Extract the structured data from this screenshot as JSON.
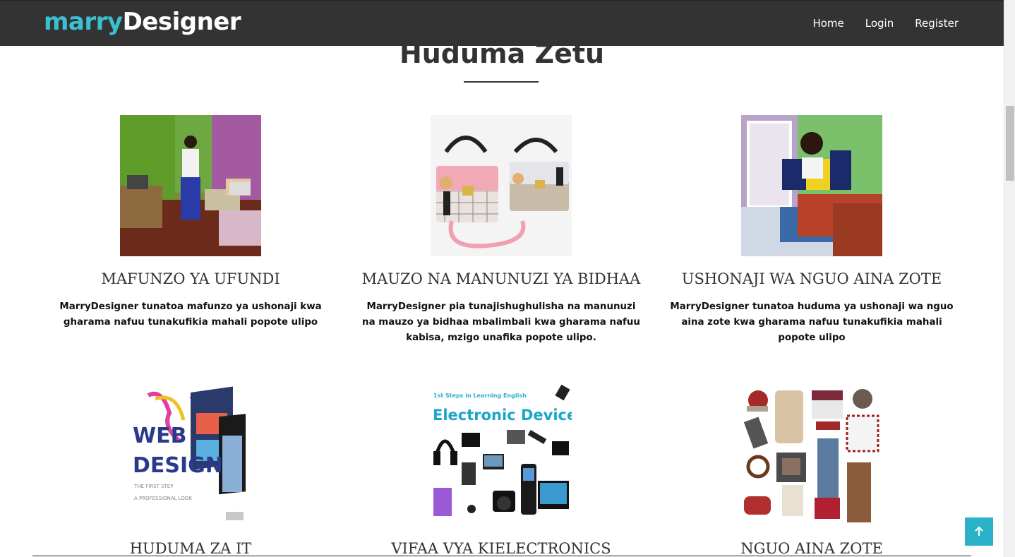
{
  "brand": {
    "part1": "marry",
    "part2": "Designer"
  },
  "nav": {
    "items": [
      {
        "label": "Home"
      },
      {
        "label": "Login"
      },
      {
        "label": "Register"
      }
    ]
  },
  "section": {
    "title": "Huduma Zetu"
  },
  "services": [
    {
      "title": "MAFUNZO YA UFUNDI",
      "text": "MarryDesigner tunatoa mafunzo ya ushonaji kwa gharama nafuu tunakufikia mahali popote ulipo",
      "image": "tailoring-workshop-photo"
    },
    {
      "title": "MAUZO NA MANUNUZI YA BIDHAA",
      "text": "MarryDesigner pia tunajishughulisha na manunuzi na mauzo ya bidhaa mbalimbali kwa gharama nafuu kabisa, mzigo unafika popote ulipo.",
      "image": "handbags-photo"
    },
    {
      "title": "USHONAJI WA NGUO AINA ZOTE",
      "text": "MarryDesigner tunatoa huduma ya ushonaji wa nguo aina zote kwa gharama nafuu tunakufikia mahali popote ulipo",
      "image": "fashion-model-photo"
    },
    {
      "title": "HUDUMA ZA IT",
      "image": "web-design-graphic",
      "image_text": {
        "line1": "WEB",
        "line2": "DESIGN",
        "line3": "THE FIRST STEP",
        "line4": "A PROFESSIONAL LOOK"
      }
    },
    {
      "title": "VIFAA VYA KIELECTRONICS",
      "image": "electronic-devices-graphic",
      "image_text": {
        "small": "1st Steps in Learning English",
        "big": "Electronic Devices"
      }
    },
    {
      "title": "NGUO AINA ZOTE",
      "image": "clothing-items-graphic"
    }
  ],
  "colors": {
    "navbar": "#333333",
    "brand_accent": "#3bc0d2",
    "to_top": "#2ab3c8"
  }
}
